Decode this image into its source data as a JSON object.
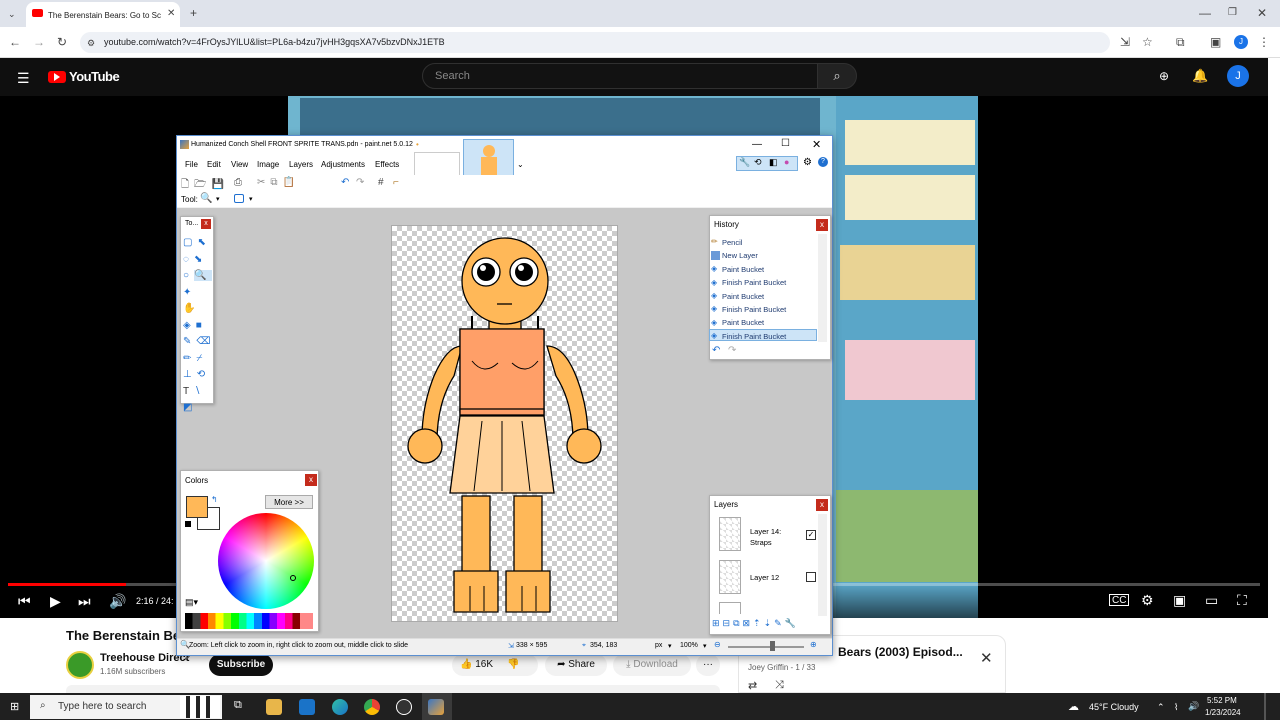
{
  "browser": {
    "tab_title": "The Berenstain Bears: Go to Sc",
    "url": "youtube.com/watch?v=4FrOysJYlLU&list=PL6a-b4zu7jvHH3gqsXA7v5bzvDNxJ1ETB",
    "profile_initial": "J"
  },
  "youtube": {
    "logo": "YouTube",
    "search_placeholder": "Search",
    "avatar_initial": "J",
    "time": "2:16 / 24:",
    "video_title": "The Berenstain Be",
    "channel": "Treehouse Direct",
    "subscribers": "1.16M subscribers",
    "subscribe": "Subscribe",
    "likes": "16K",
    "share": "Share",
    "download": "Download",
    "more": "···",
    "playlist_title": "Bears (2003) Episod...",
    "playlist_sub": "Joey Griffin - 1 / 33",
    "progress_fraction": 0.094
  },
  "pdn": {
    "title": "Humanized Conch Shell FRONT SPRITE TRANS.pdn - paint.net 5.0.12",
    "menu": [
      "File",
      "Edit",
      "View",
      "Image",
      "Layers",
      "Adjustments",
      "Effects"
    ],
    "tool_label": "Tool:",
    "tools_panel_title": "To...",
    "history_title": "History",
    "history": [
      "Pencil",
      "New Layer",
      "Paint Bucket",
      "Finish Paint Bucket",
      "Paint Bucket",
      "Finish Paint Bucket",
      "Paint Bucket",
      "Finish Paint Bucket"
    ],
    "colors_title": "Colors",
    "more_btn": "More >>",
    "layers_title": "Layers",
    "layers": [
      {
        "name": "Layer 14: Straps",
        "checked": true
      },
      {
        "name": "Layer 12",
        "checked": false
      }
    ],
    "status_hint": "Zoom: Left click to zoom in, right click to zoom out, middle click to slide",
    "image_size": "338 × 595",
    "cursor_pos": "354, 183",
    "unit": "px",
    "zoom": "100%"
  },
  "taskbar": {
    "search": "Type here to search",
    "weather": "45°F  Cloudy",
    "time": "5:52 PM",
    "date": "1/23/2024"
  },
  "colors": {
    "skin": "#ffb858",
    "top": "#ff9f68",
    "skirt": "#ffd29a"
  }
}
